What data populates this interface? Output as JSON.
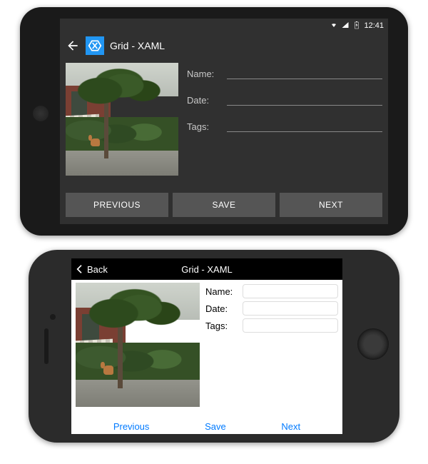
{
  "android": {
    "status_time": "12:41",
    "title": "Grid - XAML",
    "fields": {
      "name_label": "Name:",
      "date_label": "Date:",
      "tags_label": "Tags:"
    },
    "buttons": {
      "previous": "PREVIOUS",
      "save": "SAVE",
      "next": "NEXT"
    }
  },
  "ios": {
    "back_label": "Back",
    "title": "Grid - XAML",
    "fields": {
      "name_label": "Name:",
      "date_label": "Date:",
      "tags_label": "Tags:"
    },
    "buttons": {
      "previous": "Previous",
      "save": "Save",
      "next": "Next"
    }
  }
}
